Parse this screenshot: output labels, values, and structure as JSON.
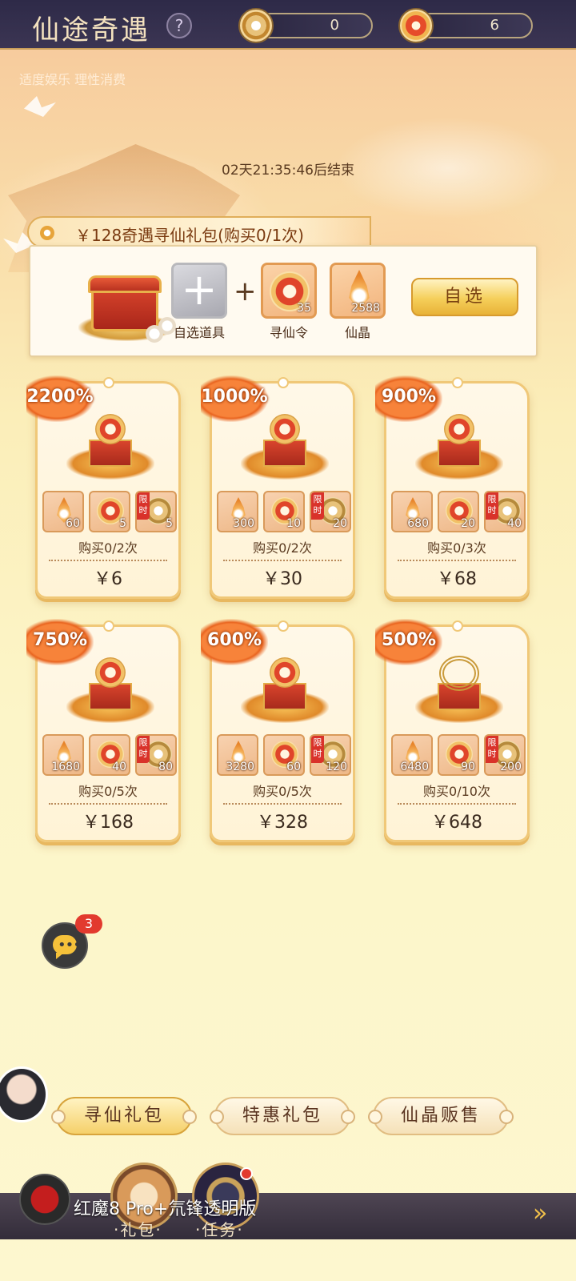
{
  "header": {
    "title": "仙途奇遇",
    "help_icon": "question-icon",
    "currency_a": {
      "icon": "coin-icon",
      "value": "0"
    },
    "currency_b": {
      "icon": "token-icon",
      "value": "6"
    }
  },
  "notice": "适度娱乐 理性消费",
  "countdown": "02天21:35:46后结束",
  "featured": {
    "title": "￥128奇遇寻仙礼包(购买0/1次)",
    "slots": [
      {
        "label": "自选道具",
        "icon": "plus-icon",
        "count": ""
      },
      {
        "label": "寻仙令",
        "icon": "token-icon",
        "count": "35"
      },
      {
        "label": "仙晶",
        "icon": "crystal-icon",
        "count": "2588"
      }
    ],
    "plus": "+",
    "choose_label": "自选"
  },
  "packs": [
    {
      "badge": "2200%",
      "items": [
        "60",
        "5",
        "5"
      ],
      "limit_tag": "限时",
      "buy": "购买0/2次",
      "price": "￥6"
    },
    {
      "badge": "1000%",
      "items": [
        "300",
        "10",
        "20"
      ],
      "limit_tag": "限时",
      "buy": "购买0/2次",
      "price": "￥30"
    },
    {
      "badge": "900%",
      "items": [
        "680",
        "20",
        "40"
      ],
      "limit_tag": "限时",
      "buy": "购买0/3次",
      "price": "￥68"
    },
    {
      "badge": "750%",
      "items": [
        "1680",
        "40",
        "80"
      ],
      "limit_tag": "限时",
      "buy": "购买0/5次",
      "price": "￥168"
    },
    {
      "badge": "600%",
      "items": [
        "3280",
        "60",
        "120"
      ],
      "limit_tag": "限时",
      "buy": "购买0/5次",
      "price": "￥328"
    },
    {
      "badge": "500%",
      "items": [
        "6480",
        "90",
        "200"
      ],
      "limit_tag": "限时",
      "buy": "购买0/10次",
      "price": "￥648"
    }
  ],
  "chat": {
    "icon": "chat-bubble-icon",
    "badge": "3"
  },
  "tabs": [
    {
      "label": "寻仙礼包",
      "active": true
    },
    {
      "label": "特惠礼包",
      "active": false
    },
    {
      "label": "仙晶贩售",
      "active": false
    }
  ],
  "bottom_nav": {
    "gift_label": "·礼包·",
    "task_label": "·任务·",
    "overlay_text": "红魔8 Pro+氘锋透明版",
    "arrow": "»"
  },
  "colors": {
    "accent": "#f5d06a",
    "badge": "#e9641f",
    "header_bg": "#2e2a48",
    "alert": "#e23a2e"
  }
}
